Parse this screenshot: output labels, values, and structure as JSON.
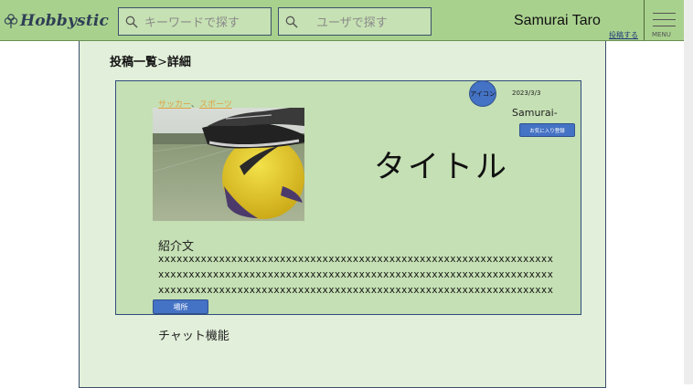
{
  "header": {
    "logo": "Hobbystic",
    "keyword_search": {
      "placeholder": "キーワードで探す"
    },
    "user_search": {
      "placeholder": "ユーザで探す"
    },
    "user_name": "Samurai Taro",
    "post_link": "投稿する",
    "menu_label": "MENU"
  },
  "breadcrumb": {
    "parent": "投稿一覧",
    "separator": ">",
    "current": "詳細"
  },
  "post": {
    "tags": [
      "サッカー",
      "スポーツ"
    ],
    "tag_separator": "、",
    "avatar_label": "アイコン",
    "date": "2023/3/3",
    "author": "Samurai-",
    "favorite_button": "お気に入り登録",
    "title": "タイトル",
    "intro_heading": "紹介文",
    "intro_lines": [
      "xxxxxxxxxxxxxxxxxxxxxxxxxxxxxxxxxxxxxxxxxxxxxxxxxxxxxxxxxxxxxxxxx",
      "xxxxxxxxxxxxxxxxxxxxxxxxxxxxxxxxxxxxxxxxxxxxxxxxxxxxxxxxxxxxxxxxx",
      "xxxxxxxxxxxxxxxxxxxxxxxxxxxxxxxxxxxxxxxxxxxxxxxxxxxxxxxxxxxxxxxxx"
    ],
    "place_button": "場所"
  },
  "chat": {
    "label": "チャット機能"
  },
  "colors": {
    "header": "#a9d18e",
    "panel": "#e2efda",
    "card": "#c5e0b4",
    "button": "#4472c4",
    "tag": "#e2a040"
  },
  "icons": {
    "logo": "clover-icon",
    "search": "search-icon",
    "menu": "hamburger-icon"
  }
}
